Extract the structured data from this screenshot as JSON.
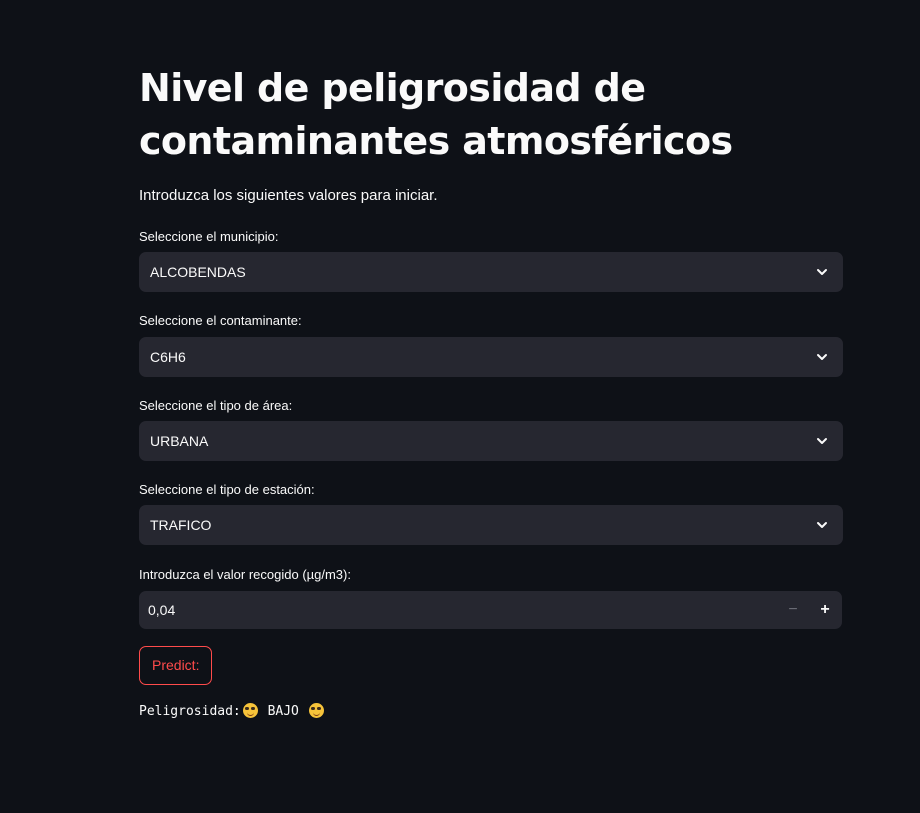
{
  "page": {
    "title": "Nivel de peligrosidad de contaminantes atmosféricos",
    "intro": "Introduzca los siguientes valores para iniciar."
  },
  "form": {
    "municipio": {
      "label": "Seleccione el municipio:",
      "value": "ALCOBENDAS"
    },
    "contaminante": {
      "label": "Seleccione el contaminante:",
      "value": "C6H6"
    },
    "area": {
      "label": "Seleccione el tipo de área:",
      "value": "URBANA"
    },
    "estacion": {
      "label": "Seleccione el tipo de estación:",
      "value": "TRAFICO"
    },
    "valor": {
      "label": "Introduzca el valor recogido (µg/m3):",
      "value": "0,04",
      "minus": "−",
      "plus": "+"
    },
    "predict_label": "Predict:"
  },
  "result": {
    "prefix": "Peligrosidad:",
    "level": "BAJO",
    "icon": "sunglasses-face-icon"
  },
  "colors": {
    "background": "#0e1117",
    "input_bg": "#262730",
    "accent": "#ff4b4b",
    "text": "#fafafa"
  }
}
